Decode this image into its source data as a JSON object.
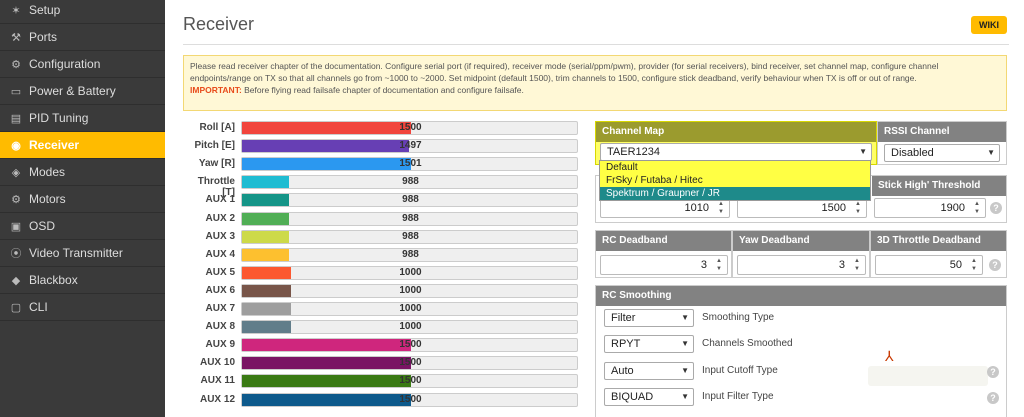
{
  "sidebar": {
    "items": [
      {
        "label": "Setup",
        "icon": "wrench-icon",
        "glyph": "✶"
      },
      {
        "label": "Ports",
        "icon": "plug-icon",
        "glyph": "⚒"
      },
      {
        "label": "Configuration",
        "icon": "gear-icon",
        "glyph": "⚙"
      },
      {
        "label": "Power & Battery",
        "icon": "battery-icon",
        "glyph": "▭"
      },
      {
        "label": "PID Tuning",
        "icon": "sliders-icon",
        "glyph": "▤"
      },
      {
        "label": "Receiver",
        "icon": "gamepad-icon",
        "glyph": "◉",
        "active": true
      },
      {
        "label": "Modes",
        "icon": "modes-icon",
        "glyph": "◈"
      },
      {
        "label": "Motors",
        "icon": "motor-icon",
        "glyph": "⚙"
      },
      {
        "label": "OSD",
        "icon": "osd-icon",
        "glyph": "▣"
      },
      {
        "label": "Video Transmitter",
        "icon": "broadcast-icon",
        "glyph": "⦿"
      },
      {
        "label": "Blackbox",
        "icon": "blackbox-icon",
        "glyph": "◆"
      },
      {
        "label": "CLI",
        "icon": "terminal-icon",
        "glyph": "▢"
      }
    ],
    "active_color": "#ffbb00"
  },
  "header": {
    "title": "Receiver",
    "wiki_label": "WIKI"
  },
  "note": {
    "text": "Please read receiver chapter of the documentation. Configure serial port (if required), receiver mode (serial/ppm/pwm), provider (for serial receivers), bind receiver, set channel map, configure channel endpoints/range on TX so that all channels go from ~1000 to ~2000. Set midpoint (default 1500), trim channels to 1500, configure stick deadband, verify behaviour when TX is off or out of range.",
    "important_label": "IMPORTANT:",
    "important_text": " Before flying read failsafe chapter of documentation and configure failsafe."
  },
  "channels": [
    {
      "label": "Roll [A]",
      "value": "1500",
      "fraction": 0.5,
      "color": "#f1453d"
    },
    {
      "label": "Pitch [E]",
      "value": "1497",
      "fraction": 0.497,
      "color": "#673fb4"
    },
    {
      "label": "Yaw [R]",
      "value": "1501",
      "fraction": 0.501,
      "color": "#2b98f0"
    },
    {
      "label": "Throttle [T]",
      "value": "988",
      "fraction": 0.14,
      "color": "#1fbcd2"
    },
    {
      "label": "AUX 1",
      "value": "988",
      "fraction": 0.14,
      "color": "#159588"
    },
    {
      "label": "AUX 2",
      "value": "988",
      "fraction": 0.14,
      "color": "#50ae55"
    },
    {
      "label": "AUX 3",
      "value": "988",
      "fraction": 0.14,
      "color": "#cdda49"
    },
    {
      "label": "AUX 4",
      "value": "988",
      "fraction": 0.14,
      "color": "#fdc02f"
    },
    {
      "label": "AUX 5",
      "value": "1000",
      "fraction": 0.145,
      "color": "#fc5830"
    },
    {
      "label": "AUX 6",
      "value": "1000",
      "fraction": 0.145,
      "color": "#785549"
    },
    {
      "label": "AUX 7",
      "value": "1000",
      "fraction": 0.145,
      "color": "#9e9e9e"
    },
    {
      "label": "AUX 8",
      "value": "1000",
      "fraction": 0.145,
      "color": "#617d8a"
    },
    {
      "label": "AUX 9",
      "value": "1500",
      "fraction": 0.5,
      "color": "#cf267d"
    },
    {
      "label": "AUX 10",
      "value": "1500",
      "fraction": 0.5,
      "color": "#7a1464"
    },
    {
      "label": "AUX 11",
      "value": "1500",
      "fraction": 0.5,
      "color": "#3a7a14"
    },
    {
      "label": "AUX 12",
      "value": "1500",
      "fraction": 0.5,
      "color": "#0d5a8c"
    }
  ],
  "channel_map": {
    "heading": "Channel Map",
    "value": "TAER1234",
    "options": [
      "Default",
      "FrSky / Futaba / Hitec",
      "Spektrum / Graupner / JR"
    ],
    "selected_index": 2
  },
  "rssi": {
    "heading": "RSSI Channel",
    "value": "Disabled"
  },
  "stick": {
    "high_heading": "Stick High' Threshold",
    "low_value": "1010",
    "center_value": "1500",
    "high_value": "1900"
  },
  "deadband": {
    "rc_heading": "RC Deadband",
    "rc_value": "3",
    "yaw_heading": "Yaw Deadband",
    "yaw_value": "3",
    "throttle_heading": "3D Throttle Deadband",
    "throttle_value": "50"
  },
  "smoothing": {
    "heading": "RC Smoothing",
    "rows": [
      {
        "value": "Filter",
        "label": "Smoothing Type"
      },
      {
        "value": "RPYT",
        "label": "Channels Smoothed"
      },
      {
        "value": "Auto",
        "label": "Input Cutoff Type"
      },
      {
        "value": "BIQUAD",
        "label": "Input Filter Type"
      }
    ]
  }
}
